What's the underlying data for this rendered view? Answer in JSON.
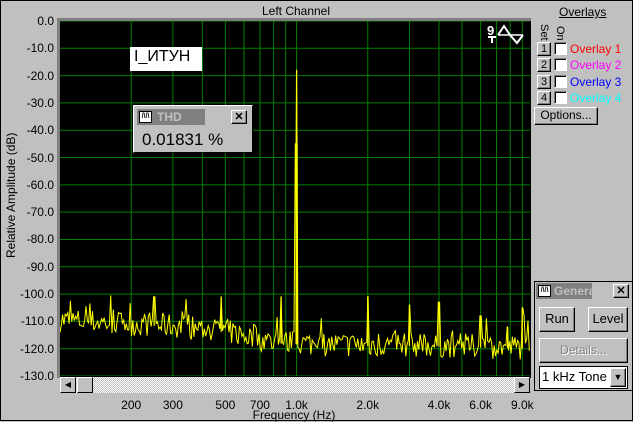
{
  "window": {
    "title": "Left Channel"
  },
  "plot": {
    "y_axis_label": "Relative Amplitude (dB)",
    "x_axis_label": "Frequency (Hz)",
    "y_ticks": [
      "0.0",
      "-10.0",
      "-20.0",
      "-30.0",
      "-40.0",
      "-50.0",
      "-60.0",
      "-70.0",
      "-80.0",
      "-90.0",
      "-100.0",
      "-110.0",
      "-120.0",
      "-130.0"
    ],
    "x_ticks": [
      "200",
      "300",
      "500",
      "700",
      "1.0k",
      "2.0k",
      "4.0k",
      "6.0k",
      "9.0k"
    ],
    "trace_label": "I_ИТУН",
    "trace_color": "#ffff00",
    "grid_color": "#008000"
  },
  "chart_data": {
    "type": "line",
    "title": "Left Channel",
    "xlabel": "Frequency (Hz)",
    "ylabel": "Relative Amplitude (dB)",
    "xscale": "log",
    "xlim": [
      100,
      9700
    ],
    "ylim": [
      -130,
      0
    ],
    "grid": true,
    "x_tick_values": [
      200,
      300,
      500,
      700,
      1000,
      2000,
      4000,
      6000,
      9000
    ],
    "grid_x": [
      200,
      300,
      400,
      500,
      600,
      700,
      800,
      900,
      1000,
      2000,
      3000,
      4000,
      5000,
      6000,
      7000,
      8000,
      9000
    ],
    "series": [
      {
        "name": "I_ИТУН",
        "color": "#ffff00",
        "peaks": [
          [
            1000,
            -18
          ],
          [
            995,
            -45
          ],
          [
            1005,
            -45
          ],
          [
            250,
            -101
          ],
          [
            480,
            -101
          ],
          [
            860,
            -101
          ],
          [
            2000,
            -101
          ],
          [
            3000,
            -104
          ],
          [
            4000,
            -103
          ],
          [
            6000,
            -108
          ],
          [
            9000,
            -105
          ],
          [
            7800,
            -112
          ]
        ],
        "noise_floor": [
          [
            100,
            -110
          ],
          [
            300,
            -112
          ],
          [
            500,
            -114
          ],
          [
            800,
            -118
          ],
          [
            1500,
            -119
          ],
          [
            3000,
            -119
          ],
          [
            9700,
            -120
          ]
        ]
      }
    ]
  },
  "thd": {
    "title": "THD",
    "value": "0.01831 %"
  },
  "overlays": {
    "header": "Overlays",
    "set_label": "Set",
    "on_label": "On",
    "items": [
      {
        "num": "1",
        "label": "Overlay 1",
        "color": "#ff0000"
      },
      {
        "num": "2",
        "label": "Overlay 2",
        "color": "#ff00ff"
      },
      {
        "num": "3",
        "label": "Overlay 3",
        "color": "#0000ff"
      },
      {
        "num": "4",
        "label": "Overlay 4",
        "color": "#00ffff"
      }
    ],
    "options_label": "Options..."
  },
  "generator": {
    "title": "Generator",
    "run_label": "Run",
    "level_label": "Level",
    "details_label": "Details...",
    "signal": "1 kHz Tone"
  }
}
